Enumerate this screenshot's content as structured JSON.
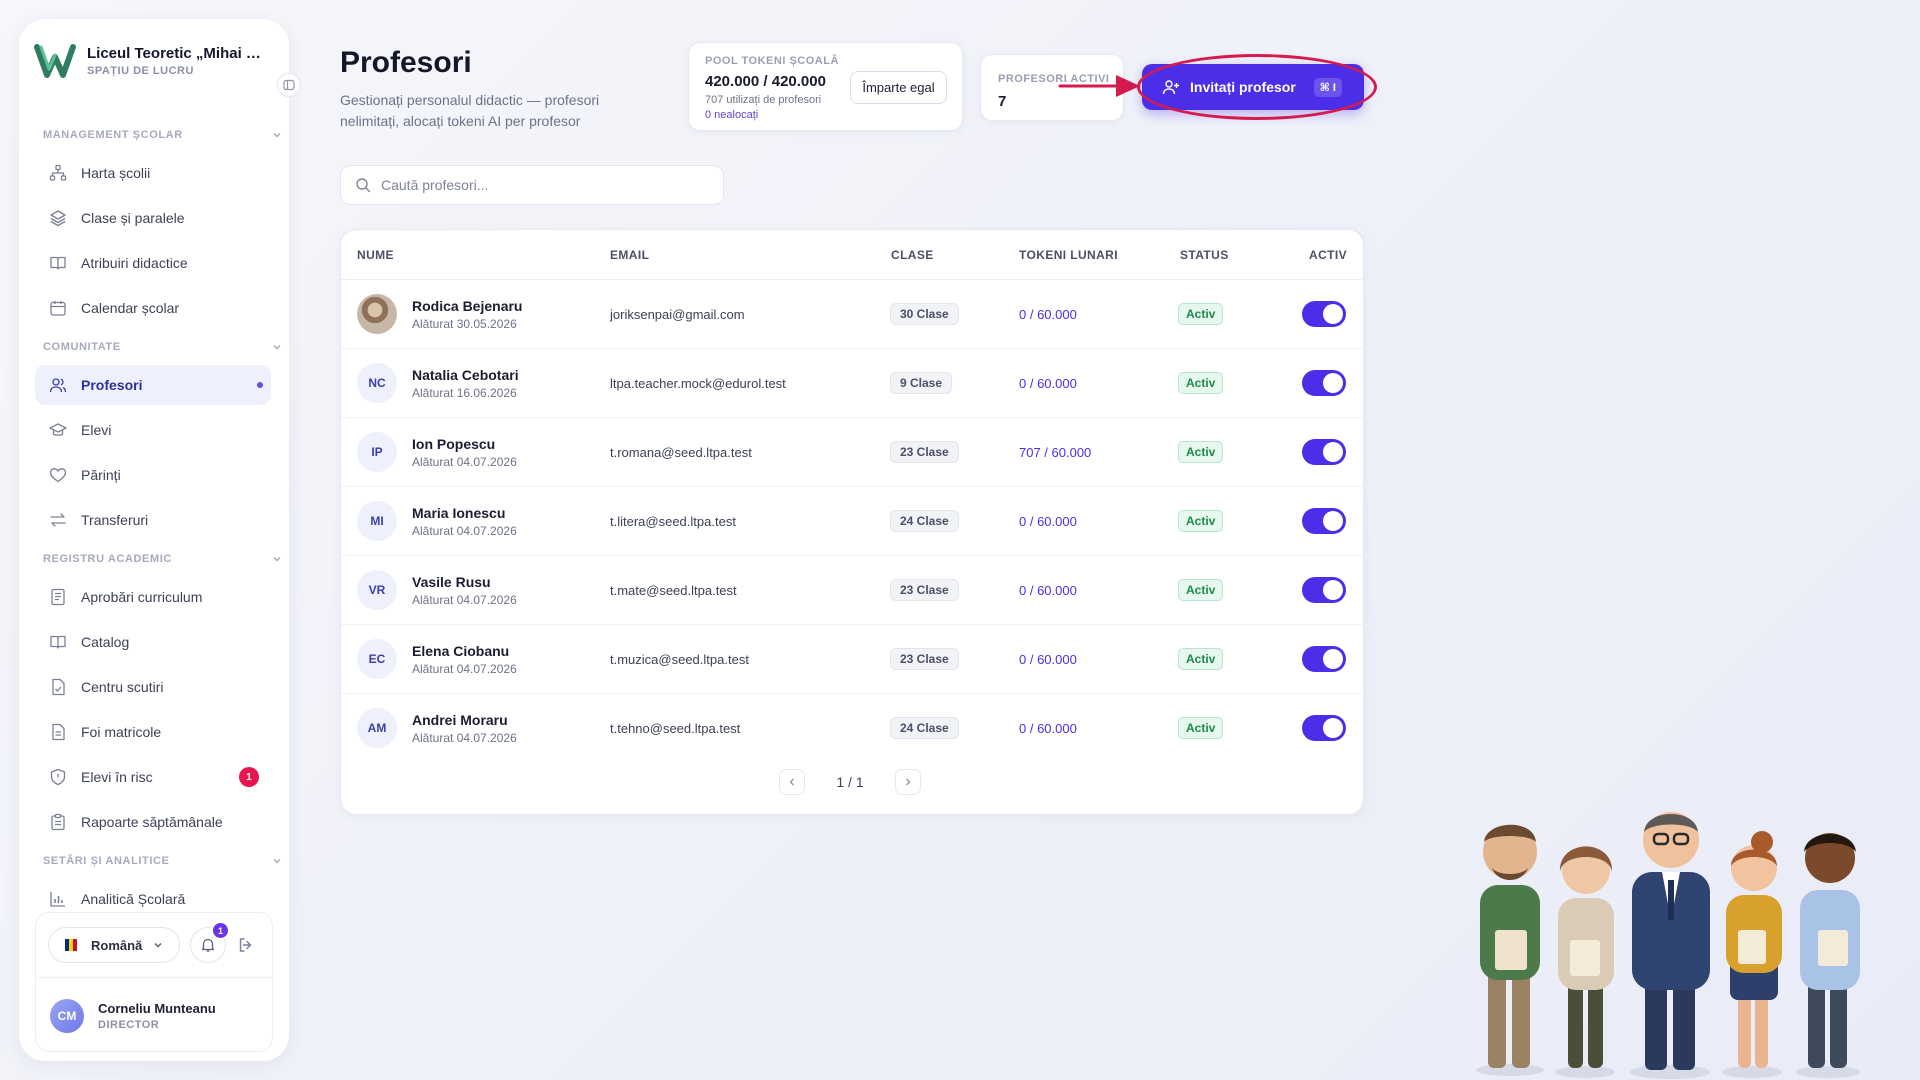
{
  "school": {
    "name": "Liceul Teoretic „Mihai Emi...",
    "workspace_label": "SPAȚIU DE LUCRU"
  },
  "sidebar": {
    "sections": [
      {
        "title": "MANAGEMENT ȘCOLAR"
      },
      {
        "title": "COMUNITATE"
      },
      {
        "title": "REGISTRU ACADEMIC"
      },
      {
        "title": "SETĂRI ȘI ANALITICE"
      }
    ],
    "items": [
      {
        "label": "Harta școlii",
        "icon": "sitemap-icon"
      },
      {
        "label": "Clase și paralele",
        "icon": "layers-icon"
      },
      {
        "label": "Atribuiri didactice",
        "icon": "book-open-icon"
      },
      {
        "label": "Calendar școlar",
        "icon": "calendar-icon"
      },
      {
        "label": "Profesori",
        "icon": "users-icon",
        "active": true
      },
      {
        "label": "Elevi",
        "icon": "graduation-cap-icon"
      },
      {
        "label": "Părinți",
        "icon": "heart-icon"
      },
      {
        "label": "Transferuri",
        "icon": "arrows-exchange-icon"
      },
      {
        "label": "Aprobări curriculum",
        "icon": "notebook-icon"
      },
      {
        "label": "Catalog",
        "icon": "book-open-icon"
      },
      {
        "label": "Centru scutiri",
        "icon": "file-check-icon"
      },
      {
        "label": "Foi matricole",
        "icon": "file-text-icon"
      },
      {
        "label": "Elevi în risc",
        "icon": "shield-icon",
        "badge": "1"
      },
      {
        "label": "Rapoarte săptămânale",
        "icon": "clipboard-icon"
      },
      {
        "label": "Analitică Școlară",
        "icon": "bar-chart-icon"
      }
    ]
  },
  "footer": {
    "language": "Română",
    "notifications_count": "1",
    "user_initials": "CM",
    "user_name": "Corneliu Munteanu",
    "user_role": "DIRECTOR"
  },
  "page": {
    "title": "Profesori",
    "subtitle": "Gestionați personalul didactic — profesori nelimitați, alocați tokeni AI per profesor"
  },
  "pool": {
    "label": "POOL TOKENI ȘCOALĂ",
    "value": "420.000 / 420.000",
    "used": "707 utilizați de profesori",
    "unallocated": "0 nealocați",
    "split_button": "Împarte egal"
  },
  "active_teachers": {
    "label": "PROFESORI ACTIVI",
    "value": "7"
  },
  "invite": {
    "label": "Invitați profesor",
    "shortcut": "⌘ I"
  },
  "search": {
    "placeholder": "Caută profesori..."
  },
  "table": {
    "columns": [
      "NUME",
      "EMAIL",
      "CLASE",
      "TOKENI LUNARI",
      "STATUS",
      "ACTIV"
    ],
    "rows": [
      {
        "initials": "",
        "photo": true,
        "name": "Rodica Bejenaru",
        "joined": "Alăturat 30.05.2026",
        "email": "joriksenpai@gmail.com",
        "classes": "30 Clase",
        "tokens": "0 / 60.000",
        "status": "Activ",
        "active": true
      },
      {
        "initials": "NC",
        "name": "Natalia Cebotari",
        "joined": "Alăturat 16.06.2026",
        "email": "ltpa.teacher.mock@edurol.test",
        "classes": "9 Clase",
        "tokens": "0 / 60.000",
        "status": "Activ",
        "active": true
      },
      {
        "initials": "IP",
        "name": "Ion Popescu",
        "joined": "Alăturat 04.07.2026",
        "email": "t.romana@seed.ltpa.test",
        "classes": "23 Clase",
        "tokens": "707 / 60.000",
        "status": "Activ",
        "active": true
      },
      {
        "initials": "MI",
        "name": "Maria Ionescu",
        "joined": "Alăturat 04.07.2026",
        "email": "t.litera@seed.ltpa.test",
        "classes": "24 Clase",
        "tokens": "0 / 60.000",
        "status": "Activ",
        "active": true
      },
      {
        "initials": "VR",
        "name": "Vasile Rusu",
        "joined": "Alăturat 04.07.2026",
        "email": "t.mate@seed.ltpa.test",
        "classes": "23 Clase",
        "tokens": "0 / 60.000",
        "status": "Activ",
        "active": true
      },
      {
        "initials": "EC",
        "name": "Elena Ciobanu",
        "joined": "Alăturat 04.07.2026",
        "email": "t.muzica@seed.ltpa.test",
        "classes": "23 Clase",
        "tokens": "0 / 60.000",
        "status": "Activ",
        "active": true
      },
      {
        "initials": "AM",
        "name": "Andrei Moraru",
        "joined": "Alăturat 04.07.2026",
        "email": "t.tehno@seed.ltpa.test",
        "classes": "24 Clase",
        "tokens": "0 / 60.000",
        "status": "Activ",
        "active": true
      }
    ]
  },
  "pagination": {
    "text": "1 / 1"
  },
  "colors": {
    "accent": "#4b2ee8",
    "highlight": "#d31b4d",
    "status_green": "#1d8a4c",
    "danger": "#e5174c"
  }
}
